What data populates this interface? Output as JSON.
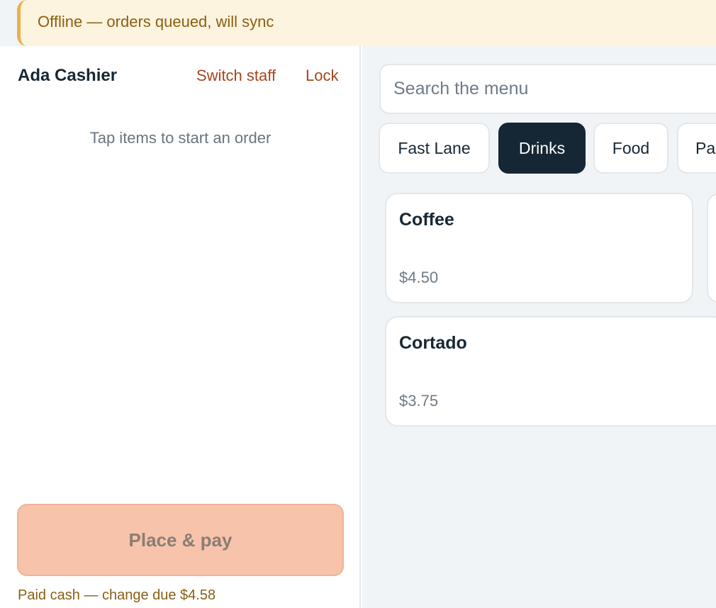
{
  "banner": {
    "text": "Offline — orders queued, will sync"
  },
  "order_panel": {
    "cashier": "Ada Cashier",
    "switch_staff_label": "Switch staff",
    "lock_label": "Lock",
    "empty_hint": "Tap items to start an order",
    "place_pay_label": "Place & pay",
    "paid_status": "Paid cash — change due $4.58"
  },
  "menu": {
    "search_placeholder": "Search the menu",
    "tabs": [
      {
        "label": "Fast Lane",
        "active": false
      },
      {
        "label": "Drinks",
        "active": true
      },
      {
        "label": "Food",
        "active": false
      },
      {
        "label": "Pastry",
        "active": false
      }
    ],
    "items": [
      {
        "name": "Coffee",
        "price": "$4.50"
      },
      {
        "name": "Cortado",
        "price": "$3.75"
      }
    ]
  },
  "colors": {
    "accent": "#a3471d",
    "dark": "#152735",
    "banner_bg": "#fdf4df",
    "banner_text": "#8a5f12",
    "place_pay_bg": "#f7c4ab"
  }
}
